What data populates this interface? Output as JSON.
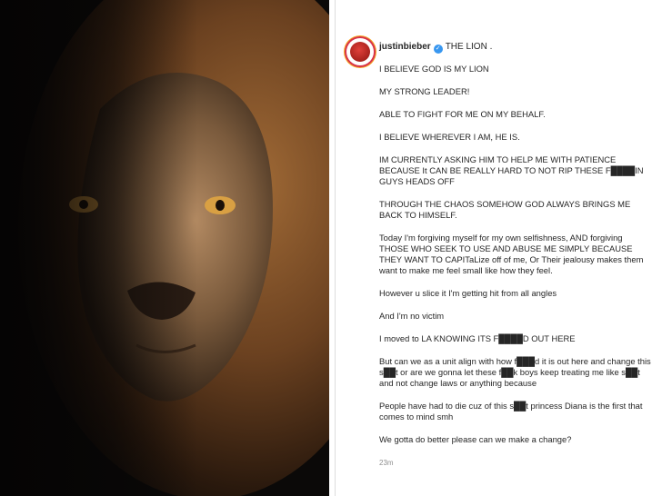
{
  "post": {
    "username": "justinbieber",
    "title_text": "THE LION .",
    "paragraphs": [
      "I BELIEVE GOD IS MY LION",
      "MY STRONG LEADER!",
      "ABLE TO FIGHT FOR ME ON MY BEHALF.",
      "I BELIEVE WHEREVER I AM, HE IS.",
      "IM CURRENTLY ASKING HIM TO HELP ME WITH PATIENCE BECAUSE It CAN BE REALLY HARD TO NOT RIP THESE F████IN GUYS HEADS OFF",
      "THROUGH THE CHAOS SOMEHOW GOD ALWAYS BRINGS ME BACK TO HIMSELF.",
      "Today I'm forgiving myself for my own selfishness, AND forgiving THOSE WHO SEEK TO USE AND ABUSE ME SIMPLY BECAUSE THEY WANT TO CAPITaLize off of me, Or Their jealousy makes them want to make me feel small like how they feel.",
      "However u slice it I'm getting hit from all angles",
      "And I'm no victim",
      "I moved to LA KNOWING ITS F████D OUT HERE",
      "But can we as a unit align with how f███d it is out here and change this s██t or are we gonna let these f██k boys keep treating me like s██t and not change laws or anything because",
      "People have had to die cuz of this s██t princess Diana is the first that comes to mind smh",
      "We gotta do better please can we make a change?"
    ],
    "timestamp": "23m"
  },
  "icons": {
    "verified": "verified-badge-icon",
    "avatar": "profile-avatar"
  },
  "colors": {
    "verified_blue": "#3897f0",
    "text": "#262626",
    "muted": "#8e8e8e"
  }
}
